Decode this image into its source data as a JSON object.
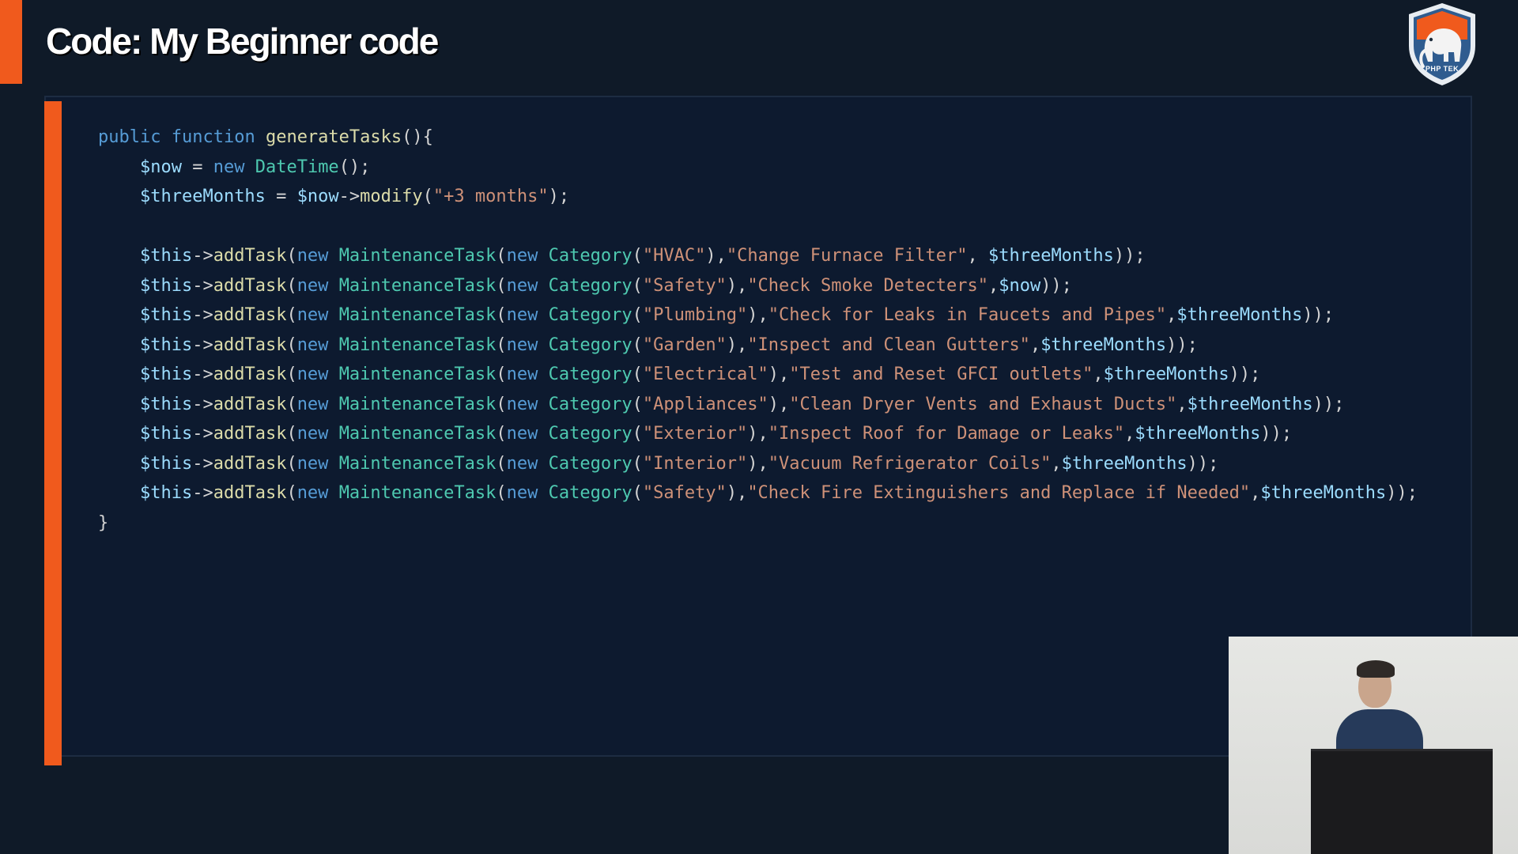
{
  "slide": {
    "title": "Code: My Beginner code",
    "logo_label": "PHP TEK",
    "logo_icon": "elephant-shield-icon",
    "accent_color": "#f05a1d",
    "background_color": "#0f1a28"
  },
  "code": {
    "language": "php",
    "lines": [
      [
        {
          "t": "public",
          "c": "kw"
        },
        {
          "t": " "
        },
        {
          "t": "function",
          "c": "kw"
        },
        {
          "t": " "
        },
        {
          "t": "generateTasks",
          "c": "fn"
        },
        {
          "t": "(){"
        }
      ],
      [
        {
          "t": "    "
        },
        {
          "t": "$now",
          "c": "var"
        },
        {
          "t": " = "
        },
        {
          "t": "new",
          "c": "kw"
        },
        {
          "t": " "
        },
        {
          "t": "DateTime",
          "c": "cls"
        },
        {
          "t": "();"
        }
      ],
      [
        {
          "t": "    "
        },
        {
          "t": "$threeMonths",
          "c": "var"
        },
        {
          "t": " = "
        },
        {
          "t": "$now",
          "c": "var"
        },
        {
          "t": "->"
        },
        {
          "t": "modify",
          "c": "fn"
        },
        {
          "t": "("
        },
        {
          "t": "\"+3 months\"",
          "c": "str"
        },
        {
          "t": ");"
        }
      ],
      [],
      [
        {
          "t": "    "
        },
        {
          "t": "$this",
          "c": "var"
        },
        {
          "t": "->"
        },
        {
          "t": "addTask",
          "c": "fn"
        },
        {
          "t": "("
        },
        {
          "t": "new",
          "c": "kw"
        },
        {
          "t": " "
        },
        {
          "t": "MaintenanceTask",
          "c": "cls"
        },
        {
          "t": "("
        },
        {
          "t": "new",
          "c": "kw"
        },
        {
          "t": " "
        },
        {
          "t": "Category",
          "c": "cls"
        },
        {
          "t": "("
        },
        {
          "t": "\"HVAC\"",
          "c": "str"
        },
        {
          "t": "),"
        },
        {
          "t": "\"Change Furnace Filter\"",
          "c": "str"
        },
        {
          "t": ", "
        },
        {
          "t": "$threeMonths",
          "c": "var"
        },
        {
          "t": "));"
        }
      ],
      [
        {
          "t": "    "
        },
        {
          "t": "$this",
          "c": "var"
        },
        {
          "t": "->"
        },
        {
          "t": "addTask",
          "c": "fn"
        },
        {
          "t": "("
        },
        {
          "t": "new",
          "c": "kw"
        },
        {
          "t": " "
        },
        {
          "t": "MaintenanceTask",
          "c": "cls"
        },
        {
          "t": "("
        },
        {
          "t": "new",
          "c": "kw"
        },
        {
          "t": " "
        },
        {
          "t": "Category",
          "c": "cls"
        },
        {
          "t": "("
        },
        {
          "t": "\"Safety\"",
          "c": "str"
        },
        {
          "t": "),"
        },
        {
          "t": "\"Check Smoke Detecters\"",
          "c": "str"
        },
        {
          "t": ","
        },
        {
          "t": "$now",
          "c": "var"
        },
        {
          "t": "));"
        }
      ],
      [
        {
          "t": "    "
        },
        {
          "t": "$this",
          "c": "var"
        },
        {
          "t": "->"
        },
        {
          "t": "addTask",
          "c": "fn"
        },
        {
          "t": "("
        },
        {
          "t": "new",
          "c": "kw"
        },
        {
          "t": " "
        },
        {
          "t": "MaintenanceTask",
          "c": "cls"
        },
        {
          "t": "("
        },
        {
          "t": "new",
          "c": "kw"
        },
        {
          "t": " "
        },
        {
          "t": "Category",
          "c": "cls"
        },
        {
          "t": "("
        },
        {
          "t": "\"Plumbing\"",
          "c": "str"
        },
        {
          "t": "),"
        },
        {
          "t": "\"Check for Leaks in Faucets and Pipes\"",
          "c": "str"
        },
        {
          "t": ","
        },
        {
          "t": "$threeMonths",
          "c": "var"
        },
        {
          "t": "));"
        }
      ],
      [
        {
          "t": "    "
        },
        {
          "t": "$this",
          "c": "var"
        },
        {
          "t": "->"
        },
        {
          "t": "addTask",
          "c": "fn"
        },
        {
          "t": "("
        },
        {
          "t": "new",
          "c": "kw"
        },
        {
          "t": " "
        },
        {
          "t": "MaintenanceTask",
          "c": "cls"
        },
        {
          "t": "("
        },
        {
          "t": "new",
          "c": "kw"
        },
        {
          "t": " "
        },
        {
          "t": "Category",
          "c": "cls"
        },
        {
          "t": "("
        },
        {
          "t": "\"Garden\"",
          "c": "str"
        },
        {
          "t": "),"
        },
        {
          "t": "\"Inspect and Clean Gutters\"",
          "c": "str"
        },
        {
          "t": ","
        },
        {
          "t": "$threeMonths",
          "c": "var"
        },
        {
          "t": "));"
        }
      ],
      [
        {
          "t": "    "
        },
        {
          "t": "$this",
          "c": "var"
        },
        {
          "t": "->"
        },
        {
          "t": "addTask",
          "c": "fn"
        },
        {
          "t": "("
        },
        {
          "t": "new",
          "c": "kw"
        },
        {
          "t": " "
        },
        {
          "t": "MaintenanceTask",
          "c": "cls"
        },
        {
          "t": "("
        },
        {
          "t": "new",
          "c": "kw"
        },
        {
          "t": " "
        },
        {
          "t": "Category",
          "c": "cls"
        },
        {
          "t": "("
        },
        {
          "t": "\"Electrical\"",
          "c": "str"
        },
        {
          "t": "),"
        },
        {
          "t": "\"Test and Reset GFCI outlets\"",
          "c": "str"
        },
        {
          "t": ","
        },
        {
          "t": "$threeMonths",
          "c": "var"
        },
        {
          "t": "));"
        }
      ],
      [
        {
          "t": "    "
        },
        {
          "t": "$this",
          "c": "var"
        },
        {
          "t": "->"
        },
        {
          "t": "addTask",
          "c": "fn"
        },
        {
          "t": "("
        },
        {
          "t": "new",
          "c": "kw"
        },
        {
          "t": " "
        },
        {
          "t": "MaintenanceTask",
          "c": "cls"
        },
        {
          "t": "("
        },
        {
          "t": "new",
          "c": "kw"
        },
        {
          "t": " "
        },
        {
          "t": "Category",
          "c": "cls"
        },
        {
          "t": "("
        },
        {
          "t": "\"Appliances\"",
          "c": "str"
        },
        {
          "t": "),"
        },
        {
          "t": "\"Clean Dryer Vents and Exhaust Ducts\"",
          "c": "str"
        },
        {
          "t": ","
        },
        {
          "t": "$threeMonths",
          "c": "var"
        },
        {
          "t": "));"
        }
      ],
      [
        {
          "t": "    "
        },
        {
          "t": "$this",
          "c": "var"
        },
        {
          "t": "->"
        },
        {
          "t": "addTask",
          "c": "fn"
        },
        {
          "t": "("
        },
        {
          "t": "new",
          "c": "kw"
        },
        {
          "t": " "
        },
        {
          "t": "MaintenanceTask",
          "c": "cls"
        },
        {
          "t": "("
        },
        {
          "t": "new",
          "c": "kw"
        },
        {
          "t": " "
        },
        {
          "t": "Category",
          "c": "cls"
        },
        {
          "t": "("
        },
        {
          "t": "\"Exterior\"",
          "c": "str"
        },
        {
          "t": "),"
        },
        {
          "t": "\"Inspect Roof for Damage or Leaks\"",
          "c": "str"
        },
        {
          "t": ","
        },
        {
          "t": "$threeMonths",
          "c": "var"
        },
        {
          "t": "));"
        }
      ],
      [
        {
          "t": "    "
        },
        {
          "t": "$this",
          "c": "var"
        },
        {
          "t": "->"
        },
        {
          "t": "addTask",
          "c": "fn"
        },
        {
          "t": "("
        },
        {
          "t": "new",
          "c": "kw"
        },
        {
          "t": " "
        },
        {
          "t": "MaintenanceTask",
          "c": "cls"
        },
        {
          "t": "("
        },
        {
          "t": "new",
          "c": "kw"
        },
        {
          "t": " "
        },
        {
          "t": "Category",
          "c": "cls"
        },
        {
          "t": "("
        },
        {
          "t": "\"Interior\"",
          "c": "str"
        },
        {
          "t": "),"
        },
        {
          "t": "\"Vacuum Refrigerator Coils\"",
          "c": "str"
        },
        {
          "t": ","
        },
        {
          "t": "$threeMonths",
          "c": "var"
        },
        {
          "t": "));"
        }
      ],
      [
        {
          "t": "    "
        },
        {
          "t": "$this",
          "c": "var"
        },
        {
          "t": "->"
        },
        {
          "t": "addTask",
          "c": "fn"
        },
        {
          "t": "("
        },
        {
          "t": "new",
          "c": "kw"
        },
        {
          "t": " "
        },
        {
          "t": "MaintenanceTask",
          "c": "cls"
        },
        {
          "t": "("
        },
        {
          "t": "new",
          "c": "kw"
        },
        {
          "t": " "
        },
        {
          "t": "Category",
          "c": "cls"
        },
        {
          "t": "("
        },
        {
          "t": "\"Safety\"",
          "c": "str"
        },
        {
          "t": "),"
        },
        {
          "t": "\"Check Fire Extinguishers and Replace if Needed\"",
          "c": "str"
        },
        {
          "t": ","
        },
        {
          "t": "$threeMonths",
          "c": "var"
        },
        {
          "t": "));"
        }
      ],
      [
        {
          "t": "}"
        }
      ]
    ]
  }
}
